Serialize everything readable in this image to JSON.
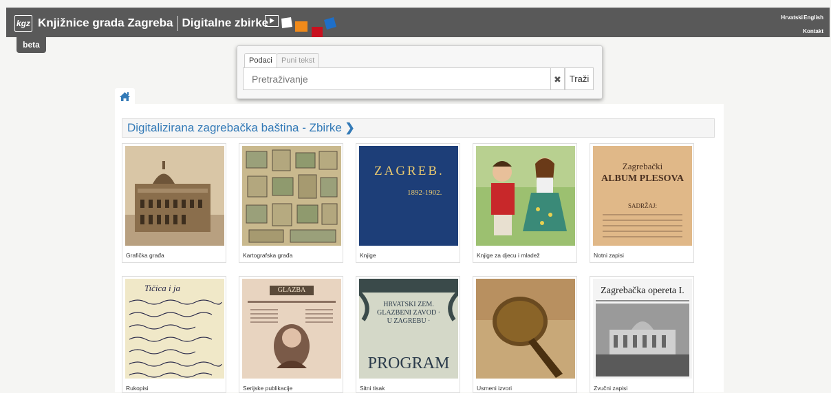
{
  "header": {
    "logo_text": "kgz",
    "library_name": "Knjižnice grada Zagreba",
    "section_name": "Digitalne zbirke",
    "languages": [
      "Hrvatski",
      "English"
    ],
    "contact": "Kontakt",
    "badge": "beta"
  },
  "search": {
    "tabs": [
      "Podaci",
      "Puni tekst"
    ],
    "placeholder": "Pretraživanje",
    "clear_symbol": "✖",
    "submit_label": "Traži"
  },
  "main": {
    "home_icon": "home-icon",
    "section_title": "Digitalizirana zagrebačka baština - Zbirke",
    "chevron": "❯",
    "collections": [
      {
        "label": "Grafička građa",
        "thumb_text": ""
      },
      {
        "label": "Kartografska građa",
        "thumb_text": ""
      },
      {
        "label": "Knjige",
        "thumb_text": "ZAGREB.",
        "thumb_sub": "1892-1902."
      },
      {
        "label": "Knjige za djecu i mladež",
        "thumb_text": ""
      },
      {
        "label": "Notni zapisi",
        "thumb_text": "Zagrebački",
        "thumb_sub": "ALBUM PLESOVA",
        "thumb_sub2": "SADRŽAJ:"
      },
      {
        "label": "Rukopisi",
        "thumb_text": "Tičica i ja"
      },
      {
        "label": "Serijske publikacije",
        "thumb_text": "GLAZBA"
      },
      {
        "label": "Sitni tisak",
        "thumb_text": "HRVATSKI ZEM. GLAZBENI ZAVOD · U ZAGREBU ·",
        "thumb_sub": "PROGRAM"
      },
      {
        "label": "Usmeni izvori",
        "thumb_text": ""
      },
      {
        "label": "Zvučni zapisi",
        "thumb_text": "Zagrebačka opereta I."
      }
    ]
  },
  "colors": {
    "header_bg": "#595959",
    "link_blue": "#337ab7",
    "tab_accent": "#f0c000"
  }
}
